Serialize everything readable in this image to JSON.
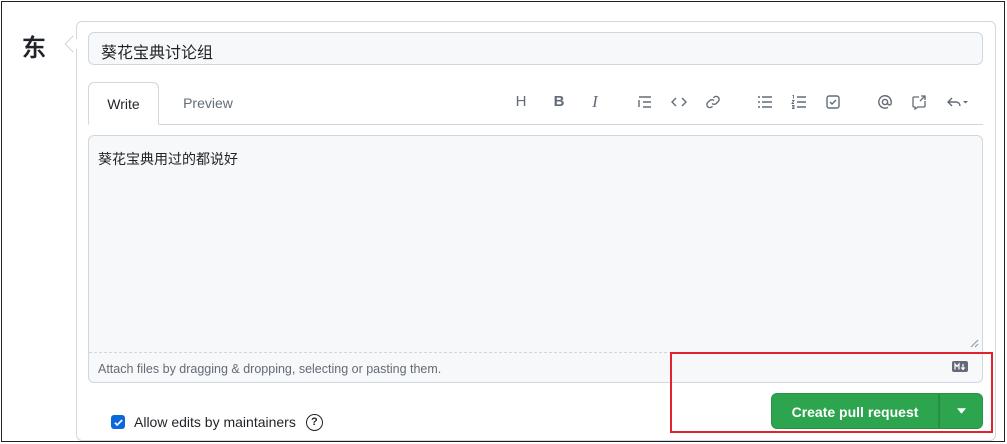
{
  "avatar_char": "东",
  "title_value": "葵花宝典讨论组",
  "tabs": {
    "write": "Write",
    "preview": "Preview"
  },
  "toolbar": {
    "heading": "H",
    "bold": "B",
    "italic": "I"
  },
  "editor": {
    "body_text": "葵花宝典用过的都说好",
    "attach_hint": "Attach files by dragging & dropping, selecting or pasting them."
  },
  "allow_edits": {
    "label": "Allow edits by maintainers",
    "checked": true,
    "help": "?"
  },
  "submit": {
    "label": "Create pull request"
  },
  "colors": {
    "primary_button": "#2da44e",
    "checkbox": "#0969da",
    "highlight": "#e0232e"
  }
}
